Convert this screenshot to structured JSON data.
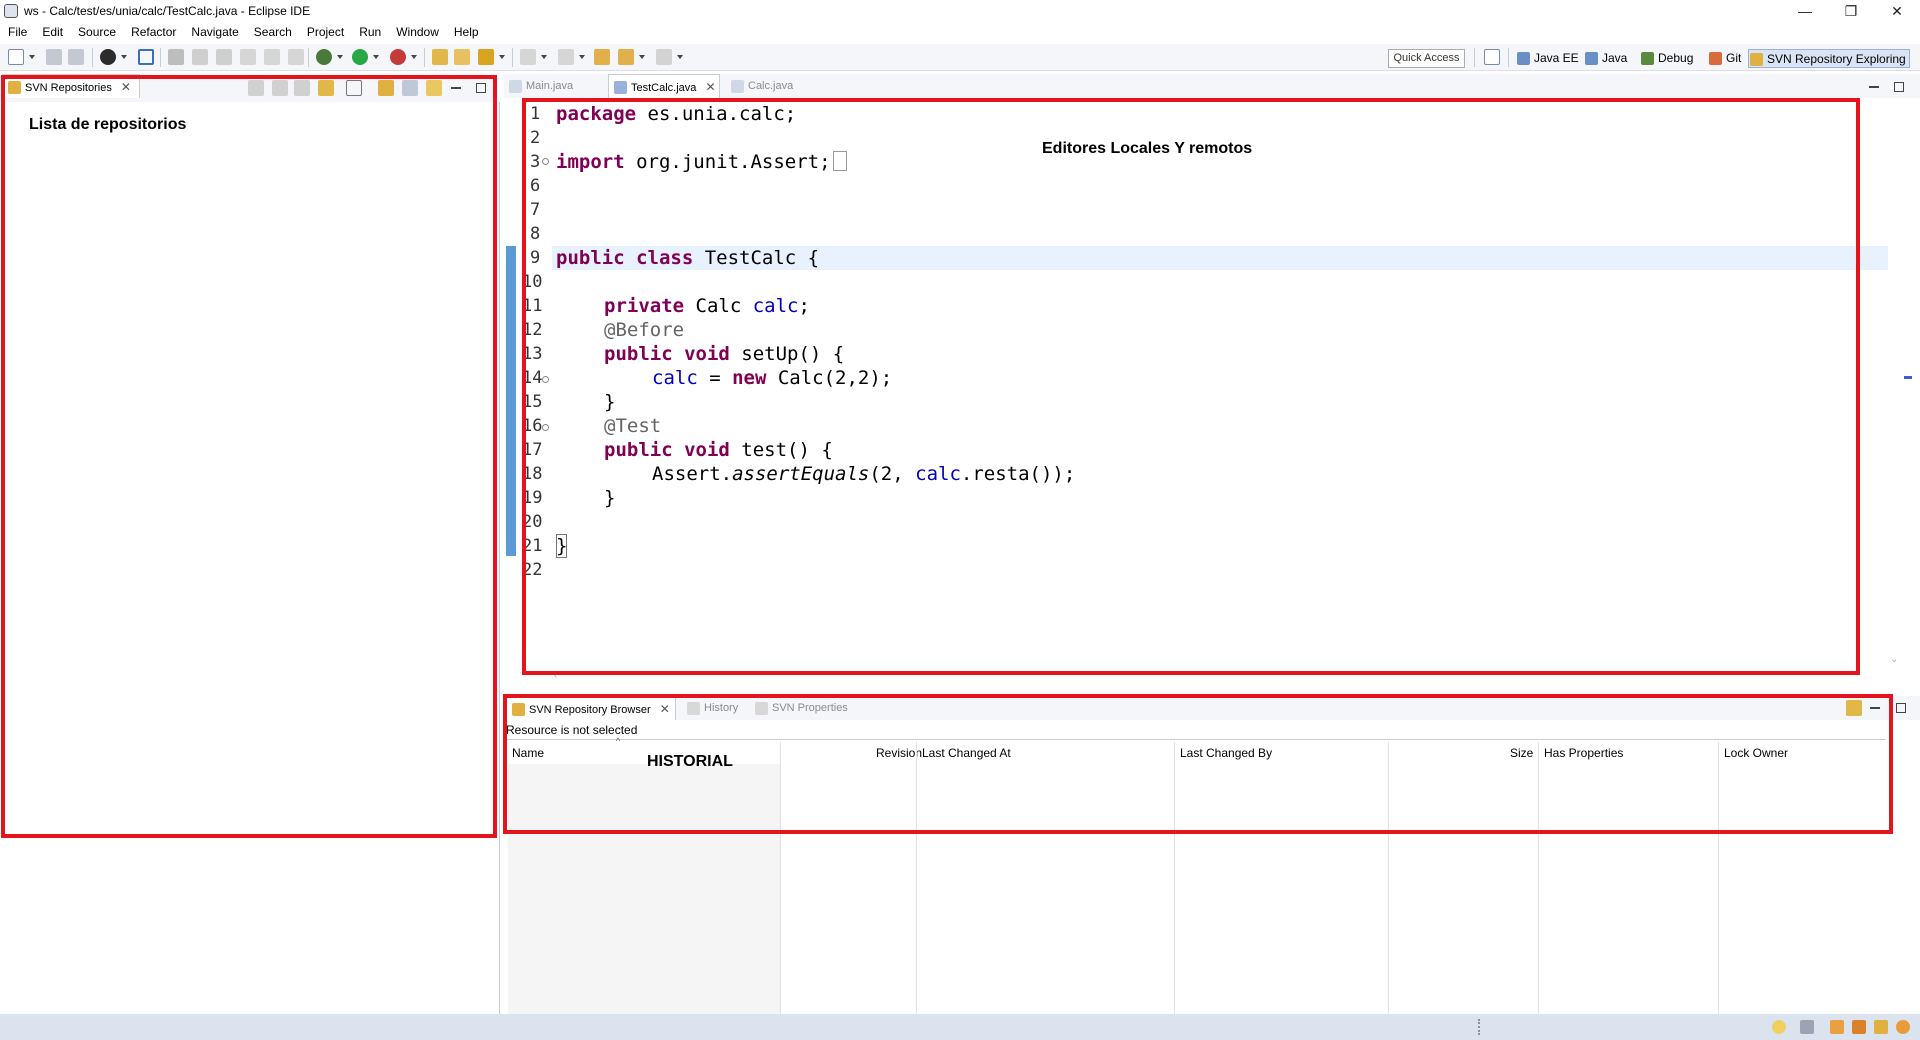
{
  "window": {
    "title": "ws - Calc/test/es/unia/calc/TestCalc.java - Eclipse IDE",
    "minimize": "—",
    "restore": "❐",
    "close": "✕"
  },
  "menu": [
    "File",
    "Edit",
    "Source",
    "Refactor",
    "Navigate",
    "Search",
    "Project",
    "Run",
    "Window",
    "Help"
  ],
  "toolbar": {
    "quick_access": "Quick Access",
    "perspectives": [
      "Java EE",
      "Java",
      "Debug",
      "Git",
      "SVN Repository Exploring"
    ]
  },
  "left_panel": {
    "tab_label": "SVN Repositories",
    "annotation": "Lista de repositorios"
  },
  "editor": {
    "tabs": [
      "Main.java",
      "TestCalc.java",
      "Calc.java"
    ],
    "active_tab": "TestCalc.java",
    "annotation": "Editores Locales Y remotos",
    "line_numbers": [
      "1",
      "2",
      "3",
      "6",
      "7",
      "8",
      "9",
      "10",
      "11",
      "12",
      "13",
      "14",
      "15",
      "16",
      "17",
      "18",
      "19",
      "20",
      "21",
      "22"
    ],
    "code": {
      "l1_kw": "package",
      "l1_rest": " es.unia.calc;",
      "l3_kw": "import",
      "l3_rest": " org.junit.Assert;",
      "l9_kw": "public class",
      "l9_rest": " TestCalc {",
      "l11_kw": "private",
      "l11_type": " Calc ",
      "l11_fld": "calc",
      "l11_end": ";",
      "l12_ann": "@Before",
      "l13_kw": "public void",
      "l13_rest": " setUp() {",
      "l14_fld": "calc",
      "l14_mid": " = ",
      "l14_kw": "new",
      "l14_rest": " Calc(2,2);",
      "l15_rest": "}",
      "l16_ann": "@Test",
      "l17_kw": "public void",
      "l17_rest": " test() {",
      "l18_a": "Assert.",
      "l18_it": "assertEquals",
      "l18_b": "(2, ",
      "l18_fld": "calc",
      "l18_c": ".resta());",
      "l19_rest": "}",
      "l21_rest": "}"
    }
  },
  "bottom_panel": {
    "tabs": [
      "SVN Repository Browser",
      "History",
      "SVN Properties"
    ],
    "status": "Resource is not selected",
    "annotation": "HISTORIAL",
    "columns": [
      "Name",
      "Revision",
      "Last Changed At",
      "Last Changed By",
      "Size",
      "Has Properties",
      "Lock Owner"
    ]
  },
  "colors": {
    "annotation_frame": "#e4141c",
    "keyword": "#7f0055",
    "field": "#0000c0",
    "annotation_code": "#646464"
  }
}
